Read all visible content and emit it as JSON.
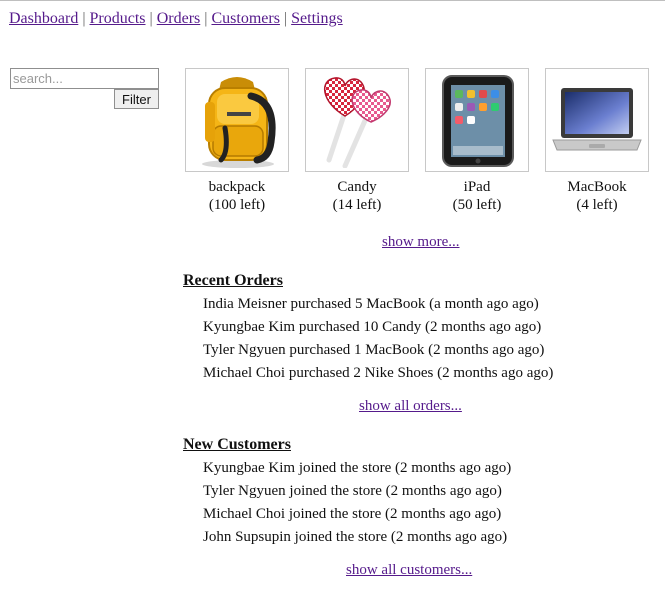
{
  "nav": {
    "links": [
      "Dashboard",
      "Products",
      "Orders",
      "Customers",
      "Settings"
    ],
    "separator": "|"
  },
  "search": {
    "placeholder": "search...",
    "value": "",
    "button_label": "Filter"
  },
  "products": [
    {
      "name": "backpack",
      "stock": "(100 left)",
      "icon": "backpack-icon"
    },
    {
      "name": "Candy",
      "stock": "(14 left)",
      "icon": "candy-icon"
    },
    {
      "name": "iPad",
      "stock": "(50 left)",
      "icon": "ipad-icon"
    },
    {
      "name": "MacBook",
      "stock": "(4 left)",
      "icon": "macbook-icon"
    }
  ],
  "show_more_label": "show more...",
  "recent_orders": {
    "title": "Recent Orders",
    "items": [
      "India Meisner purchased 5 MacBook (a month ago ago)",
      "Kyungbae Kim purchased 10 Candy (2 months ago ago)",
      "Tyler Ngyuen purchased 1 MacBook (2 months ago ago)",
      "Michael Choi purchased 2 Nike Shoes (2 months ago ago)"
    ],
    "link_label": "show all orders..."
  },
  "new_customers": {
    "title": "New Customers",
    "items": [
      "Kyungbae Kim joined the store (2 months ago ago)",
      "Tyler Ngyuen joined the store (2 months ago ago)",
      "Michael Choi joined the store (2 months ago ago)",
      "John Supsupin joined the store (2 months ago ago)"
    ],
    "link_label": "show all customers..."
  },
  "colors": {
    "link": "#551a8b",
    "text": "#111111",
    "border": "#c8c8c8"
  }
}
